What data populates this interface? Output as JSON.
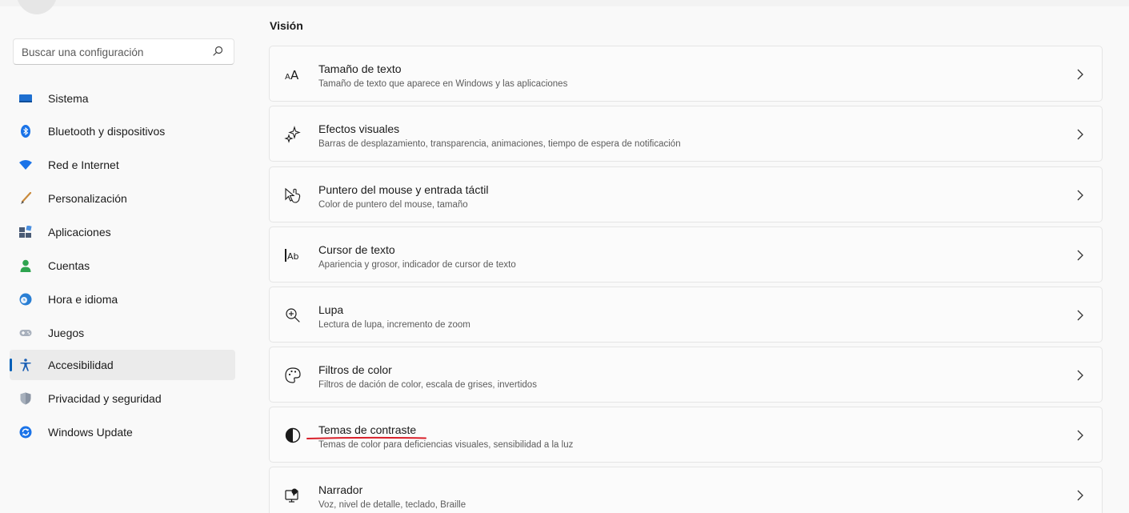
{
  "search": {
    "placeholder": "Buscar una configuración"
  },
  "sidebar": {
    "items": [
      {
        "label": "Sistema",
        "icon": "monitor-icon"
      },
      {
        "label": "Bluetooth y dispositivos",
        "icon": "bluetooth-icon"
      },
      {
        "label": "Red e Internet",
        "icon": "wifi-icon"
      },
      {
        "label": "Personalización",
        "icon": "brush-icon"
      },
      {
        "label": "Aplicaciones",
        "icon": "apps-icon"
      },
      {
        "label": "Cuentas",
        "icon": "person-icon"
      },
      {
        "label": "Hora e idioma",
        "icon": "globe-clock-icon"
      },
      {
        "label": "Juegos",
        "icon": "gamepad-icon"
      },
      {
        "label": "Accesibilidad",
        "icon": "accessibility-icon",
        "active": true
      },
      {
        "label": "Privacidad y seguridad",
        "icon": "shield-icon"
      },
      {
        "label": "Windows Update",
        "icon": "update-icon"
      }
    ]
  },
  "main": {
    "section_title": "Visión",
    "cards": [
      {
        "title": "Tamaño de texto",
        "subtitle": "Tamaño de texto que aparece en Windows y las aplicaciones",
        "icon": "text-size-icon"
      },
      {
        "title": "Efectos visuales",
        "subtitle": "Barras de desplazamiento, transparencia, animaciones, tiempo de espera de notificación",
        "icon": "sparkle-icon"
      },
      {
        "title": "Puntero del mouse y entrada táctil",
        "subtitle": "Color de puntero del mouse, tamaño",
        "icon": "pointer-touch-icon"
      },
      {
        "title": "Cursor de texto",
        "subtitle": "Apariencia y grosor, indicador de cursor de texto",
        "icon": "text-cursor-icon"
      },
      {
        "title": "Lupa",
        "subtitle": "Lectura de lupa, incremento de zoom",
        "icon": "magnifier-icon"
      },
      {
        "title": "Filtros de color",
        "subtitle": "Filtros de dación de color, escala de grises, invertidos",
        "icon": "palette-icon"
      },
      {
        "title": "Temas de contraste",
        "subtitle": "Temas de color para deficiencias visuales, sensibilidad a la luz",
        "icon": "contrast-icon"
      },
      {
        "title": "Narrador",
        "subtitle": "Voz, nivel de detalle, teclado, Braille",
        "icon": "narrator-icon"
      }
    ]
  },
  "colors": {
    "accent": "#005fb8",
    "annotation": "#d9202a"
  }
}
